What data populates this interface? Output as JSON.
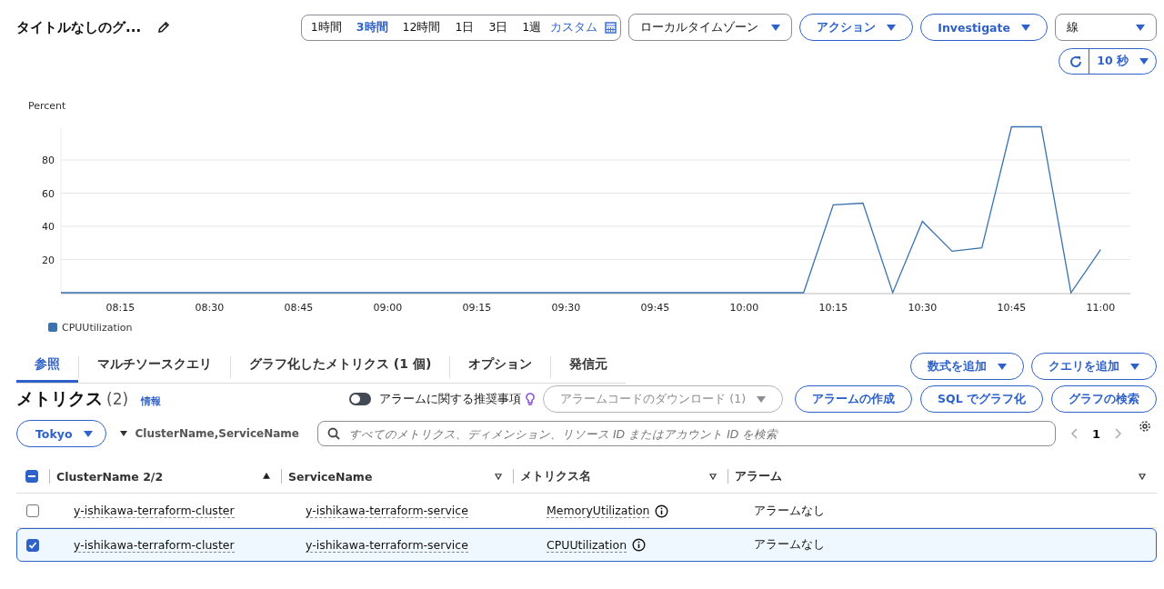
{
  "header": {
    "title": "タイトルなしのグ...",
    "time_ranges": [
      {
        "label": "1時間",
        "selected": false
      },
      {
        "label": "3時間",
        "selected": true
      },
      {
        "label": "12時間",
        "selected": false
      },
      {
        "label": "1日",
        "selected": false
      },
      {
        "label": "3日",
        "selected": false
      },
      {
        "label": "1週",
        "selected": false
      },
      {
        "label": "カスタム",
        "selected": false
      }
    ],
    "timezone": "ローカルタイムゾーン",
    "actions": "アクション",
    "investigate": "Investigate",
    "chart_type": "線",
    "refresh_interval": "10 秒"
  },
  "chart": {
    "chart_data": {
      "type": "line",
      "ylabel": "Percent",
      "grid": true,
      "categories": [
        null,
        null,
        "08:15",
        null,
        null,
        "08:30",
        null,
        null,
        "08:45",
        null,
        null,
        "09:00",
        null,
        null,
        "09:15",
        null,
        null,
        "09:30",
        null,
        null,
        "09:45",
        null,
        null,
        "10:00",
        null,
        null,
        "10:15",
        null,
        null,
        "10:30",
        null,
        null,
        "10:45",
        null,
        null,
        "11:00"
      ],
      "series": [
        {
          "name": "CPUUtilization",
          "color": "#3a72b0",
          "values": [
            0,
            0,
            0,
            0,
            0,
            0,
            0,
            0,
            0,
            0,
            0,
            0,
            0,
            0,
            0,
            0,
            0,
            0,
            0,
            0,
            0,
            0,
            0,
            0,
            0,
            0,
            53,
            54,
            0,
            43,
            25,
            27,
            100,
            100,
            0,
            26
          ]
        }
      ],
      "yticks": [
        20,
        40,
        60,
        80
      ],
      "ylim": [
        0,
        100
      ]
    }
  },
  "tabs": [
    {
      "label": "参照",
      "selected": true
    },
    {
      "label": "マルチソースクエリ",
      "selected": false
    },
    {
      "label": "グラフ化したメトリクス (1 個)",
      "selected": false
    },
    {
      "label": "オプション",
      "selected": false
    },
    {
      "label": "発信元",
      "selected": false
    }
  ],
  "tab_buttons": [
    "数式を追加",
    "クエリを追加"
  ],
  "metrics": {
    "title": "メトリクス",
    "count": "(2)",
    "info": "情報",
    "alarm_toggle": {
      "label": "アラームに関する推奨事項",
      "on": false
    },
    "download": {
      "label": "アラームコードのダウンロード (1)",
      "disabled": true
    },
    "buttons": [
      "アラームの作成",
      "SQL でグラフ化",
      "グラフの検索"
    ],
    "region": "Tokyo",
    "dimension": "ClusterName,ServiceName",
    "search": {
      "placeholder": "すべてのメトリクス、ディメンション、リソース ID またはアカウント ID を検索"
    },
    "page": "1"
  },
  "table": {
    "select_all": {
      "indeterminate": true
    },
    "columns": [
      {
        "label": "ClusterName 2/2",
        "sorted": true
      },
      {
        "label": "ServiceName",
        "sorted": false
      },
      {
        "label": "メトリクス名",
        "sorted": false
      },
      {
        "label": "アラーム",
        "sorted": false
      }
    ],
    "rows": [
      {
        "selected": false,
        "cells": [
          "y-ishikawa-terraform-cluster",
          "y-ishikawa-terraform-service",
          "MemoryUtilization",
          "アラームなし"
        ]
      },
      {
        "selected": true,
        "cells": [
          "y-ishikawa-terraform-cluster",
          "y-ishikawa-terraform-service",
          "CPUUtilization",
          "アラームなし"
        ]
      }
    ]
  }
}
